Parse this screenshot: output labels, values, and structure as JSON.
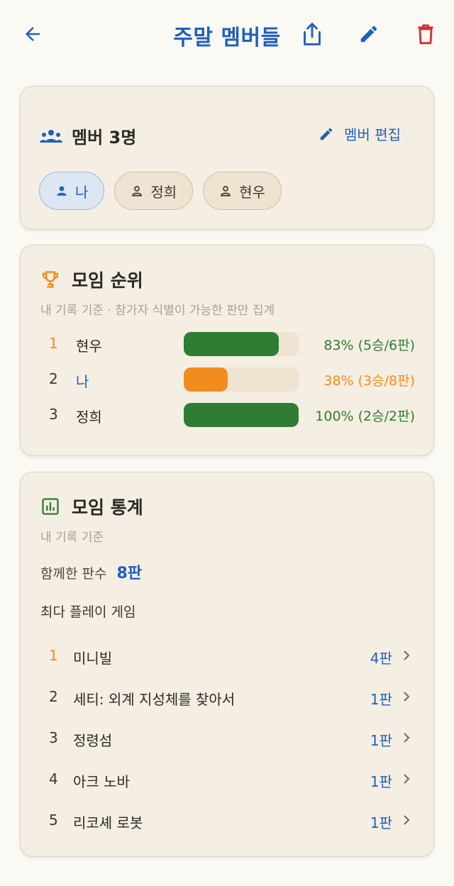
{
  "header": {
    "title": "주말 멤버들"
  },
  "members": {
    "title": "멤버 3명",
    "edit_label": "멤버 편집",
    "chips": [
      {
        "label": "나",
        "selected": true
      },
      {
        "label": "정희",
        "selected": false
      },
      {
        "label": "현우",
        "selected": false
      }
    ]
  },
  "ranking": {
    "title": "모임 순위",
    "subtitle": "내 기록 기준 · 참가자 식별이 가능한 판만 집계",
    "rows": [
      {
        "rank": "1",
        "name": "현우",
        "ratio": 0.83,
        "color": "#2e7d32",
        "rank_color": "#ef8a1f",
        "name_color": "#2b2a26",
        "text": "83% (5승/6판)"
      },
      {
        "rank": "2",
        "name": "나",
        "ratio": 0.38,
        "color": "#f28c1f",
        "rank_color": "#3a3833",
        "name_color": "#1f5fbf",
        "text": "38% (3승/8판)"
      },
      {
        "rank": "3",
        "name": "정희",
        "ratio": 1.0,
        "color": "#2e7d32",
        "rank_color": "#3a3833",
        "name_color": "#2b2a26",
        "text": "100% (2승/2판)"
      }
    ]
  },
  "stats": {
    "title": "모임 통계",
    "subtitle": "내 기록 기준",
    "together_label": "함께한 판수",
    "together_value": "8판",
    "most_played_label": "최다 플레이 게임",
    "games": [
      {
        "rank": "1",
        "name": "미니빌",
        "plays": "4판",
        "rank_color": "#ef8a1f"
      },
      {
        "rank": "2",
        "name": "세티: 외계 지성체를 찾아서",
        "plays": "1판",
        "rank_color": "#3a3833"
      },
      {
        "rank": "3",
        "name": "정령섬",
        "plays": "1판",
        "rank_color": "#3a3833"
      },
      {
        "rank": "4",
        "name": "아크 노바",
        "plays": "1판",
        "rank_color": "#3a3833"
      },
      {
        "rank": "5",
        "name": "리코셰 로봇",
        "plays": "1판",
        "rank_color": "#3a3833"
      }
    ]
  },
  "colors": {
    "accent": "#1f5fbf",
    "delete": "#d32f2f",
    "orange": "#ef8a1f",
    "green": "#2e7d32"
  },
  "icons": [
    "back-arrow-icon",
    "share-icon",
    "pencil-icon",
    "trash-icon",
    "group-icon",
    "person-icon",
    "trophy-icon",
    "bar-chart-icon",
    "chevron-right-icon"
  ]
}
